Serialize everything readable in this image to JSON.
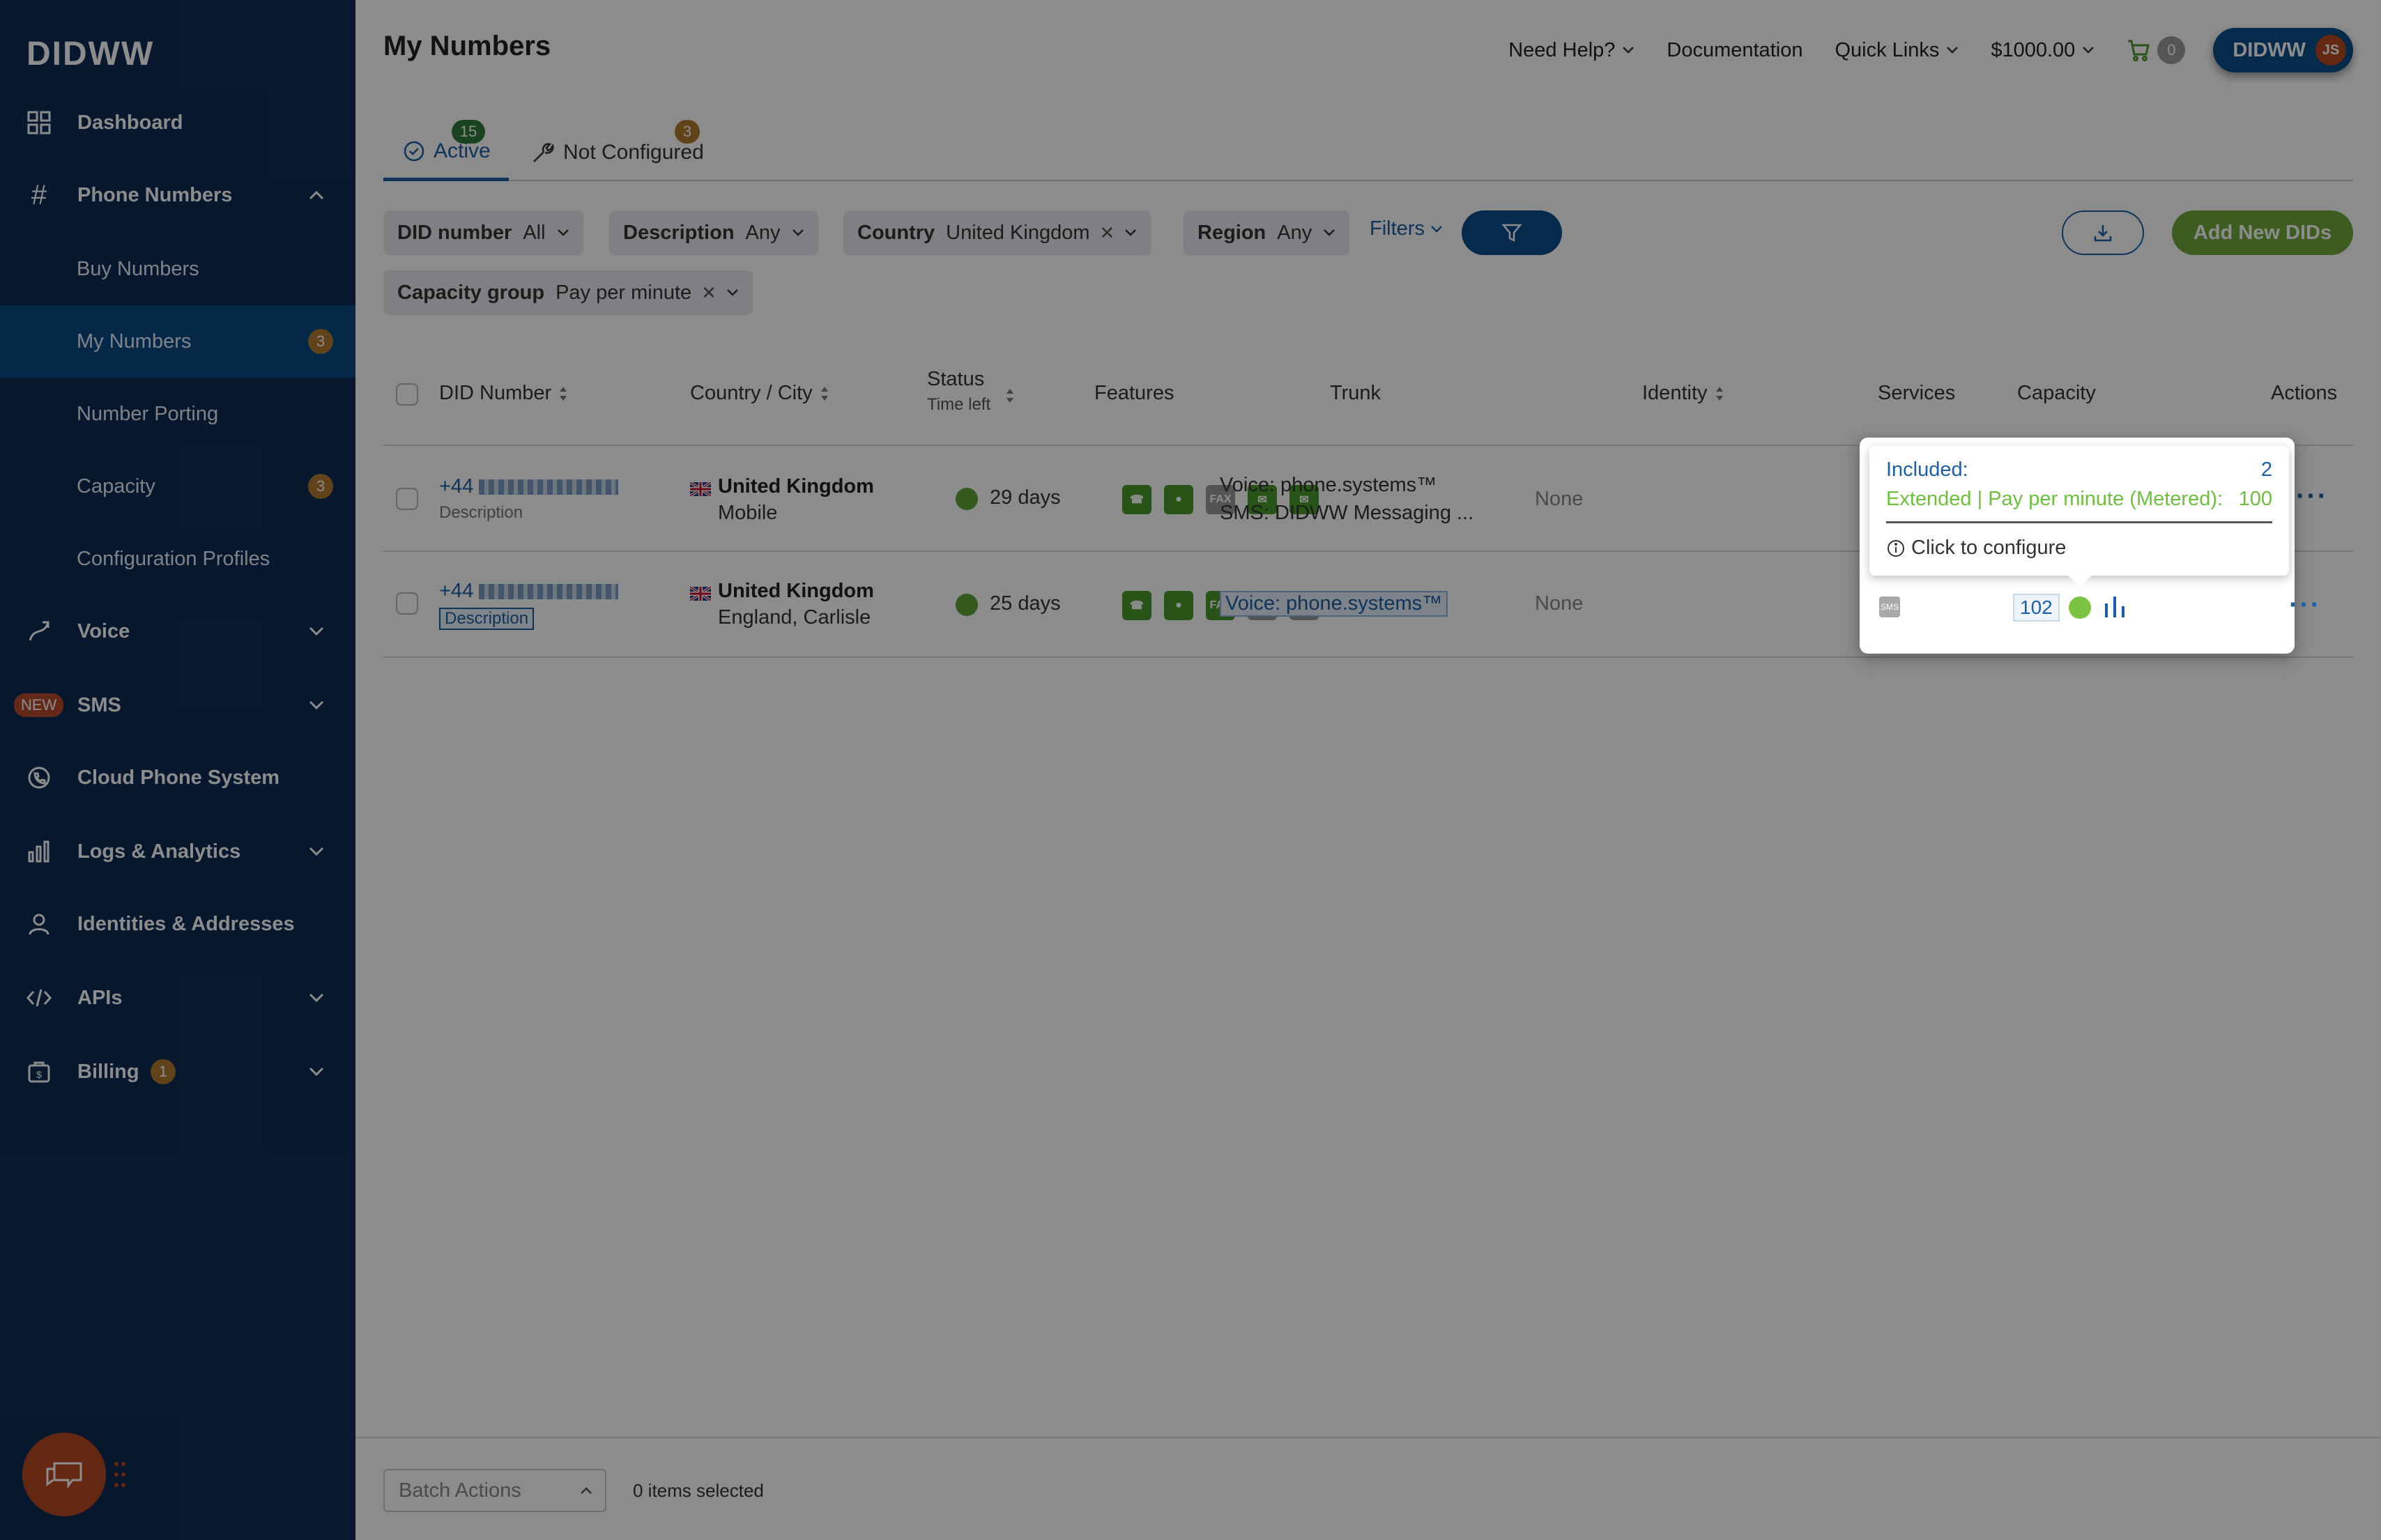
{
  "sidebar": {
    "logo": "DIDWW",
    "items": [
      {
        "label": "Dashboard"
      },
      {
        "label": "Phone Numbers"
      },
      {
        "label": "Voice"
      },
      {
        "label": "SMS",
        "badge": "NEW"
      },
      {
        "label": "Cloud Phone System"
      },
      {
        "label": "Logs & Analytics"
      },
      {
        "label": "Identities & Addresses"
      },
      {
        "label": "APIs"
      },
      {
        "label": "Billing",
        "badge": "1"
      }
    ],
    "sub_items": [
      {
        "label": "Buy Numbers"
      },
      {
        "label": "My Numbers",
        "badge": "3"
      },
      {
        "label": "Number Porting"
      },
      {
        "label": "Capacity",
        "badge": "3"
      },
      {
        "label": "Configuration Profiles"
      }
    ]
  },
  "header": {
    "title": "My Numbers",
    "need_help": "Need Help?",
    "documentation": "Documentation",
    "quick_links": "Quick Links",
    "balance": "$1000.00",
    "cart_count": "0",
    "account": "DIDWW",
    "avatar_initials": "JS"
  },
  "tabs": [
    {
      "label": "Active",
      "badge": "15"
    },
    {
      "label": "Not Configured",
      "badge": "3"
    }
  ],
  "filters": {
    "did_number": {
      "label": "DID number",
      "value": "All"
    },
    "description": {
      "label": "Description",
      "value": "Any"
    },
    "country": {
      "label": "Country",
      "value": "United Kingdom"
    },
    "region": {
      "label": "Region",
      "value": "Any"
    },
    "filters_link": "Filters",
    "capacity_group": {
      "label": "Capacity group",
      "value": "Pay per minute"
    }
  },
  "buttons": {
    "add_new": "Add New DIDs"
  },
  "table": {
    "headers": {
      "did": "DID Number",
      "country": "Country / City",
      "status": "Status",
      "status_sub": "Time left",
      "features": "Features",
      "trunk": "Trunk",
      "identity": "Identity",
      "services": "Services",
      "capacity": "Capacity",
      "actions": "Actions"
    },
    "rows": [
      {
        "did": "+44",
        "description": "Description",
        "country": "United Kingdom",
        "city": "Mobile",
        "status": "29 days",
        "trunk_line1": "Voice: phone.systems™",
        "trunk_line2": "SMS: DIDWW Messaging ...",
        "identity": "None"
      },
      {
        "did": "+44",
        "description": "Description",
        "country": "United Kingdom",
        "city": "England, Carlisle",
        "status": "25 days",
        "trunk_line1": "Voice: phone.systems™",
        "identity": "None",
        "capacity": "102"
      }
    ]
  },
  "tooltip": {
    "included_label": "Included:",
    "included_value": "2",
    "extended_label": "Extended | Pay per minute (Metered):",
    "extended_value": "100",
    "configure": "Click to configure"
  },
  "footer": {
    "batch_actions": "Batch Actions",
    "selected": "0 items selected"
  },
  "colors": {
    "sidebar_bg": "#0c2b55",
    "accent_blue": "#1a5fa8",
    "accent_green": "#6fa83a",
    "badge_orange": "#b27a2e"
  }
}
